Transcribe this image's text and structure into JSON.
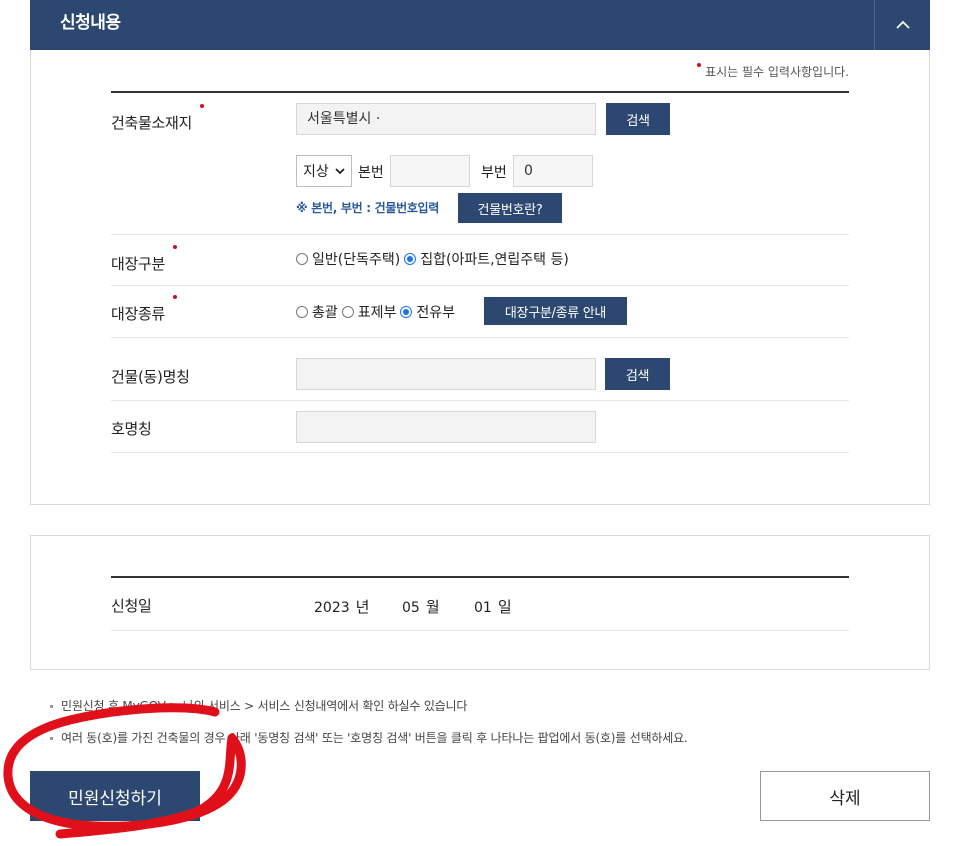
{
  "panel": {
    "title": "신청내용",
    "required_note": "표시는 필수 입력사항입니다."
  },
  "address": {
    "label": "건축물소재지",
    "value": "서울특별시 ·",
    "search_label": "검색",
    "land_type": "지상",
    "main_no_label": "본번",
    "main_no_value": "",
    "sub_no_label": "부번",
    "sub_no_value": "0",
    "hint": "※ 본번, 부번 : 건물번호입력",
    "building_no_help": "건물번호란?"
  },
  "ledger_category": {
    "label": "대장구분",
    "options": [
      {
        "label": "일반(단독주택)",
        "selected": false
      },
      {
        "label": "집합(아파트,연립주택 등)",
        "selected": true
      }
    ]
  },
  "ledger_type": {
    "label": "대장종류",
    "options": [
      {
        "label": "총괄",
        "selected": false
      },
      {
        "label": "표제부",
        "selected": false
      },
      {
        "label": "전유부",
        "selected": true
      }
    ],
    "guide_label": "대장구분/종류 안내"
  },
  "building_name": {
    "label": "건물(동)명칭",
    "search_label": "검색"
  },
  "unit_name": {
    "label": "호명칭"
  },
  "application_date": {
    "label": "신청일",
    "year": "2023",
    "year_unit": "년",
    "month": "05",
    "month_unit": "월",
    "day": "01",
    "day_unit": "일"
  },
  "notices": [
    "민원신청 후 MyGOV > 나의 서비스 > 서비스 신청내역에서 확인 하실수 있습니다",
    "여러 동(호)를 가진 건축물의 경우 아래 '동명칭 검색' 또는 '호명칭 검색' 버튼을 클릭 후 나타나는 팝업에서 동(호)를 선택하세요."
  ],
  "actions": {
    "apply_label": "민원신청하기",
    "delete_label": "삭제"
  },
  "colors": {
    "navy": "#2d4870",
    "required": "#d0121b",
    "annotation": "#e0101a"
  }
}
